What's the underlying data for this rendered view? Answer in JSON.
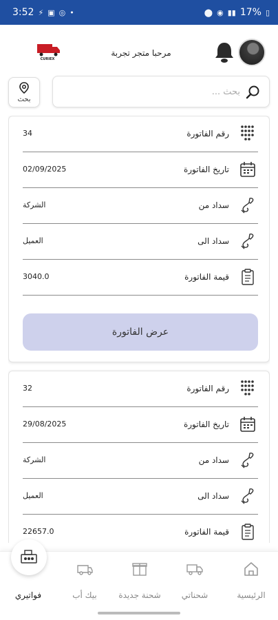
{
  "status_bar": {
    "time": "3:52",
    "battery": "17%"
  },
  "header": {
    "greeting": "مرحبا متجر تجربة",
    "logo_text": "CURIEX"
  },
  "search": {
    "placeholder": "بحث ...",
    "filter_label": "بحث"
  },
  "labels": {
    "invoice_number": "رقم الفاتورة",
    "invoice_date": "تاريخ الفاتورة",
    "paid_from": "سداد من",
    "paid_to": "سداد الى",
    "invoice_value": "قيمة الفاتورة",
    "view_invoice": "عرض الفاتورة"
  },
  "invoices": [
    {
      "number": "34",
      "date": "02/09/2025",
      "from": "الشركة",
      "to": "العميل",
      "value": "3040.0"
    },
    {
      "number": "32",
      "date": "29/08/2025",
      "from": "الشركة",
      "to": "العميل",
      "value": "22657.0"
    }
  ],
  "bottom_nav": {
    "home": "الرئيسية",
    "my_shipments": "شحناتي",
    "new_shipment": "شحنة جديدة",
    "pickup": "بيك أب",
    "my_invoices": "فواتيري"
  },
  "colors": {
    "status_bar": "#1f4fa1",
    "view_button": "#ced1ec"
  }
}
